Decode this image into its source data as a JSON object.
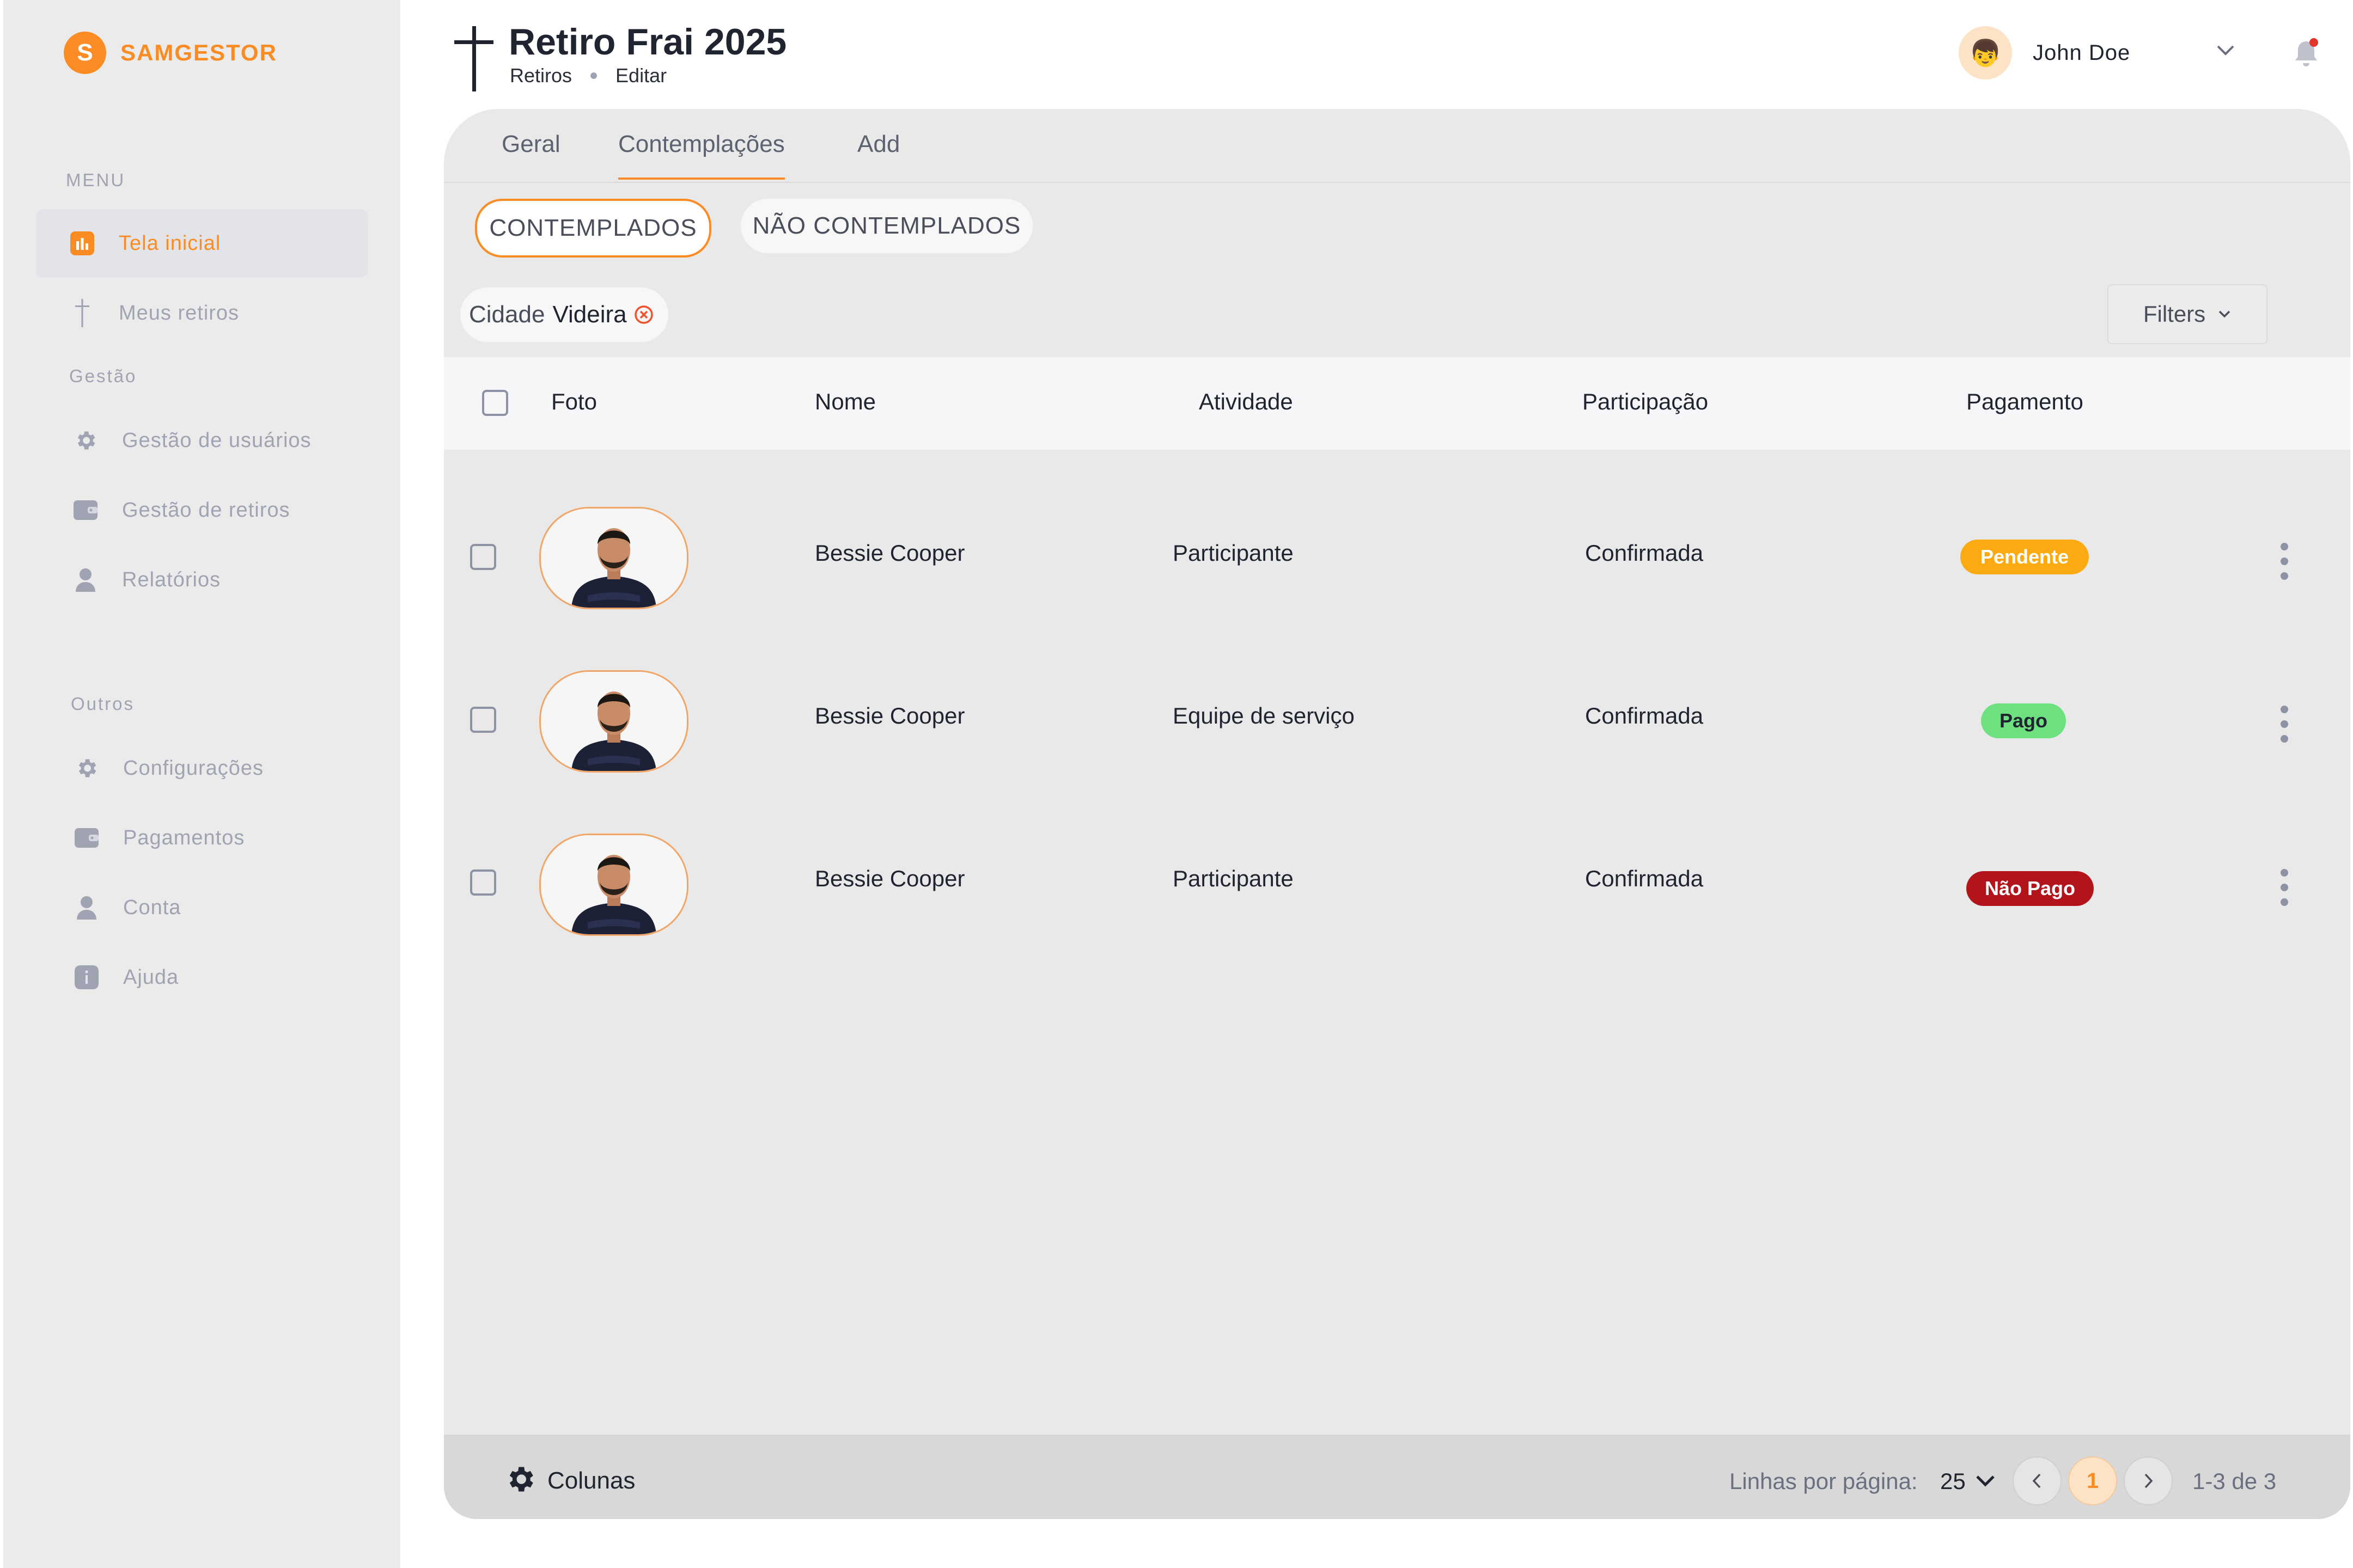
{
  "sidebar": {
    "logo_letter": "S",
    "logo_text": "SAMGESTOR",
    "menu_label": "MENU",
    "gestao_label": "Gestão",
    "outros_label": "Outros",
    "items": [
      {
        "label": "Tela inicial",
        "icon": "chart-icon",
        "active": true
      },
      {
        "label": "Meus retiros",
        "icon": "cross-icon"
      },
      {
        "label": "Gestão de usuários",
        "icon": "gear-icon"
      },
      {
        "label": "Gestão de retiros",
        "icon": "wallet-icon"
      },
      {
        "label": "Relatórios",
        "icon": "user-icon"
      },
      {
        "label": "Configurações",
        "icon": "gear-icon"
      },
      {
        "label": "Pagamentos",
        "icon": "wallet-icon"
      },
      {
        "label": "Conta",
        "icon": "user-icon"
      },
      {
        "label": "Ajuda",
        "icon": "info-icon"
      }
    ]
  },
  "header": {
    "title": "Retiro Frai 2025",
    "breadcrumb": [
      "Retiros",
      "Editar"
    ],
    "user_name": "John Doe",
    "avatar_emoji": "👦"
  },
  "tabs": [
    "Geral",
    "Contemplações",
    "Add"
  ],
  "active_tab": "Contemplações",
  "toggle": {
    "contemplados": "CONTEMPLADOS",
    "nao_contemplados": "NÃO CONTEMPLADOS"
  },
  "filter_chip": {
    "key": "Cidade",
    "value": "Videira"
  },
  "filters_label": "Filters",
  "table": {
    "columns": [
      "Foto",
      "Nome",
      "Atividade",
      "Participação",
      "Pagamento"
    ],
    "rows": [
      {
        "nome": "Bessie Cooper",
        "atividade": "Participante",
        "participacao": "Confirmada",
        "pagamento": "Pendente"
      },
      {
        "nome": "Bessie Cooper",
        "atividade": "Equipe de serviço",
        "participacao": "Confirmada",
        "pagamento": "Pago"
      },
      {
        "nome": "Bessie Cooper",
        "atividade": "Participante",
        "participacao": "Confirmada",
        "pagamento": "Não Pago"
      }
    ]
  },
  "status_colors": {
    "Pendente": "#fbaa12",
    "Pago": "#6ee07f",
    "Não Pago": "#b3141c"
  },
  "footer": {
    "columns_label": "Colunas",
    "rows_per_page_label": "Linhas por página:",
    "rows_per_page": "25",
    "current_page": "1",
    "range": "1-3 de 3"
  },
  "colors": {
    "accent": "#fb8c23",
    "sidebar_bg": "#ebebeb",
    "panel_bg": "#e9e9e9"
  }
}
